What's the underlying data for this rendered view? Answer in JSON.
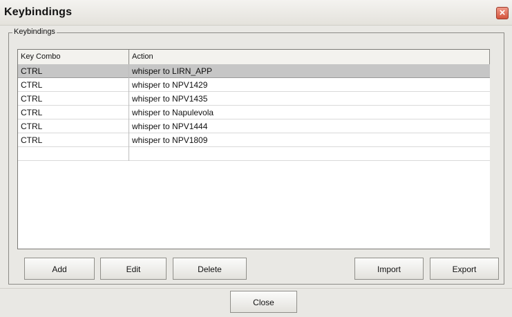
{
  "window": {
    "title": "Keybindings",
    "close_glyph": "×"
  },
  "groupbox": {
    "label": "Keybindings"
  },
  "table": {
    "columns": [
      "Key Combo",
      "Action"
    ],
    "rows": [
      {
        "key": "CTRL",
        "action": "whisper to LIRN_APP"
      },
      {
        "key": "CTRL",
        "action": "whisper to NPV1429"
      },
      {
        "key": "CTRL",
        "action": "whisper to NPV1435"
      },
      {
        "key": "CTRL",
        "action": "whisper to Napulevola"
      },
      {
        "key": "CTRL",
        "action": "whisper to NPV1444"
      },
      {
        "key": "CTRL",
        "action": "whisper to NPV1809"
      }
    ],
    "selected_row": 0
  },
  "buttons": {
    "add": "Add",
    "edit": "Edit",
    "delete": "Delete",
    "import": "Import",
    "export": "Export",
    "close": "Close"
  },
  "colors": {
    "selected_row": "#c6c6c6",
    "close_button": "#d4543c"
  }
}
